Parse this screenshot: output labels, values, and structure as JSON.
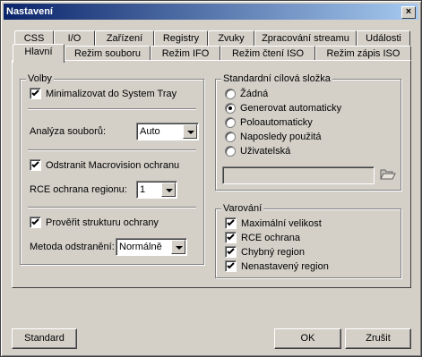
{
  "window": {
    "title": "Nastavení",
    "close_glyph": "×"
  },
  "tabs_row1": [
    "CSS",
    "I/O",
    "Zařízení",
    "Registry",
    "Zvuky",
    "Zpracování streamu",
    "Události"
  ],
  "tabs_row2": [
    "Hlavní",
    "Režim souboru",
    "Režim IFO",
    "Režim čtení ISO",
    "Režim zápis ISO"
  ],
  "active_tab": "Hlavní",
  "volby": {
    "title": "Volby",
    "minimize_tray": {
      "label": "Minimalizovat do System Tray",
      "checked": true
    },
    "file_analysis": {
      "label": "Analýza souborů:",
      "value": "Auto"
    },
    "macrovision": {
      "label": "Odstranit Macrovision ochranu",
      "checked": true
    },
    "rce_region": {
      "label": "RCE ochrana regionu:",
      "value": "1"
    },
    "verify_structure": {
      "label": "Prověřit strukturu ochrany",
      "checked": true
    },
    "removal_method": {
      "label": "Metoda odstranění:",
      "value": "Normálně"
    }
  },
  "target_folder": {
    "title": "Standardní cílová složka",
    "options": [
      "Žádná",
      "Generovat automaticky",
      "Poloautomaticky",
      "Naposledy použitá",
      "Uživatelská"
    ],
    "selected": "Generovat automaticky",
    "path_value": "",
    "folder_icon": "folder-open-icon"
  },
  "warnings": {
    "title": "Varování",
    "items": [
      {
        "label": "Maximální velikost",
        "checked": true
      },
      {
        "label": "RCE ochrana",
        "checked": true
      },
      {
        "label": "Chybný region",
        "checked": true
      },
      {
        "label": "Nenastavený region",
        "checked": true
      }
    ]
  },
  "buttons": {
    "standard": "Standard",
    "ok": "OK",
    "cancel": "Zrušit"
  }
}
